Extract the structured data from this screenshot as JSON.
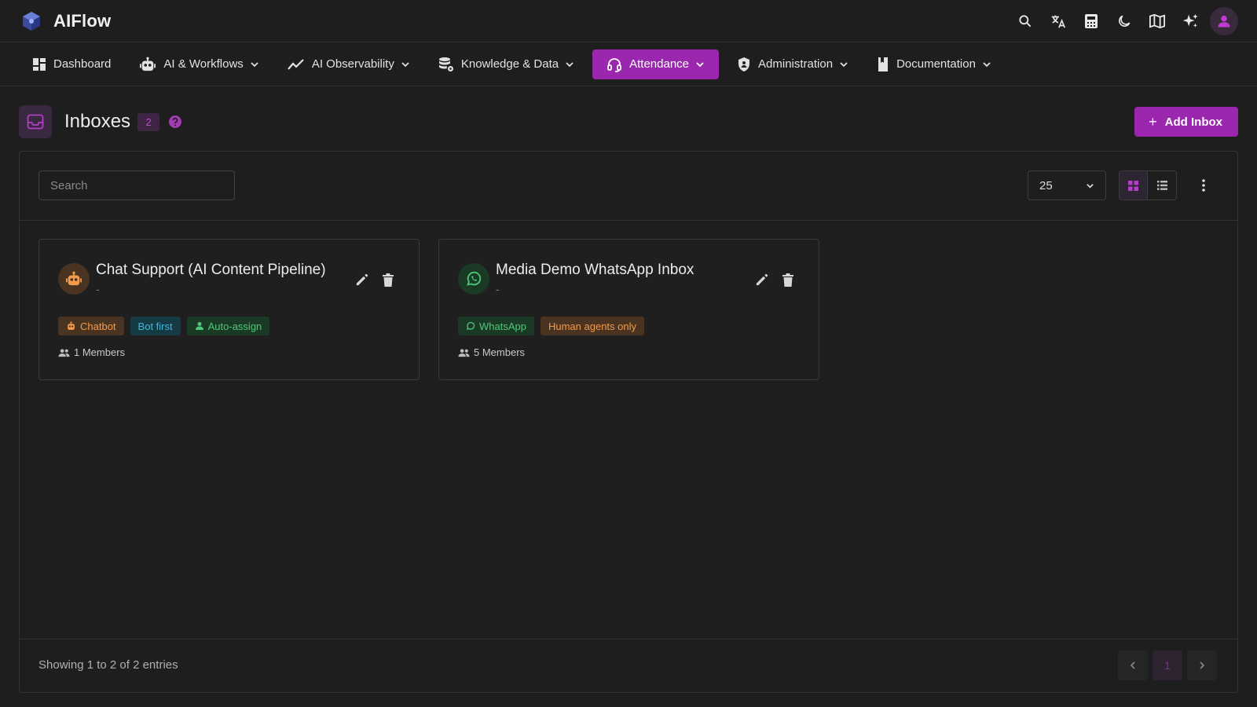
{
  "app": {
    "name": "AIFlow",
    "logo_icon": "cube-logo-icon"
  },
  "top_icons": [
    "search-icon",
    "translate-icon",
    "calculator-icon",
    "moon-icon",
    "book-icon",
    "sparkles-icon",
    "user-icon"
  ],
  "nav": {
    "items": [
      {
        "label": "Dashboard",
        "icon": "dashboard-icon",
        "dropdown": false
      },
      {
        "label": "AI & Workflows",
        "icon": "robot-icon",
        "dropdown": true
      },
      {
        "label": "AI Observability",
        "icon": "trend-icon",
        "dropdown": true
      },
      {
        "label": "Knowledge & Data",
        "icon": "database-icon",
        "dropdown": true
      },
      {
        "label": "Attendance",
        "icon": "headset-icon",
        "dropdown": true,
        "active": true
      },
      {
        "label": "Administration",
        "icon": "shield-icon",
        "dropdown": true
      },
      {
        "label": "Documentation",
        "icon": "bookmark-icon",
        "dropdown": true
      }
    ]
  },
  "page": {
    "title": "Inboxes",
    "count": "2",
    "add_button": "Add Inbox"
  },
  "toolbar": {
    "search_placeholder": "Search",
    "search_value": "",
    "page_size": "25",
    "view_mode": "grid"
  },
  "cards": [
    {
      "title": "Chat Support (AI Content Pipeline)",
      "subtitle": "-",
      "avatar_icon": "robot-icon",
      "tags": [
        {
          "label": "Chatbot",
          "color": "orange",
          "icon": "robot-icon"
        },
        {
          "label": "Bot first",
          "color": "cyan"
        },
        {
          "label": "Auto-assign",
          "color": "green",
          "icon": "person-icon"
        }
      ],
      "members": "1 Members"
    },
    {
      "title": "Media Demo WhatsApp Inbox",
      "subtitle": "-",
      "avatar_icon": "whatsapp-icon",
      "tags": [
        {
          "label": "WhatsApp",
          "color": "green",
          "icon": "whatsapp-icon"
        },
        {
          "label": "Human agents only",
          "color": "orange"
        }
      ],
      "members": "5 Members"
    }
  ],
  "footer": {
    "entries_text": "Showing 1 to 2 of 2 entries",
    "current_page": "1"
  },
  "colors": {
    "accent": "#9b27af",
    "background": "#1e1e1e",
    "tag_orange": "#f29b4b",
    "tag_cyan": "#3fb8d8",
    "tag_green": "#4ec777"
  }
}
